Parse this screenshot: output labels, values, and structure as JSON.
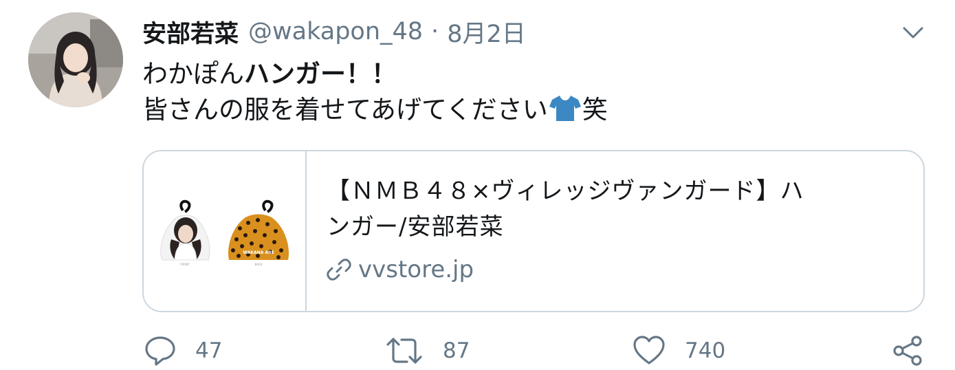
{
  "tweet": {
    "display_name": "安部若菜",
    "handle": "@wakapon_48",
    "separator": "·",
    "date": "8月2日",
    "text_line1_plain": "わかぽん",
    "text_line1_bold": "ハンガー！！",
    "text_line2_before": "皆さんの服を着せてあげてください",
    "text_line2_emoji": "t-shirt-emoji",
    "text_line2_after": "笑"
  },
  "card": {
    "title_line1": "【ＮＭＢ４８×ヴィレッジヴァンガード】ハ",
    "title_line2": "ンガー/安部若菜",
    "domain": "vvstore.jp",
    "thumbnail_caption": "WAKANA ABE"
  },
  "actions": {
    "reply": {
      "icon": "reply-icon",
      "count": "47"
    },
    "retweet": {
      "icon": "retweet-icon",
      "count": "87"
    },
    "like": {
      "icon": "heart-icon",
      "count": "740"
    },
    "share": {
      "icon": "share-icon"
    }
  },
  "colors": {
    "text": "#14171a",
    "secondary": "#657786",
    "border": "#ccd6dd",
    "emoji_shirt": "#3b88c3"
  }
}
